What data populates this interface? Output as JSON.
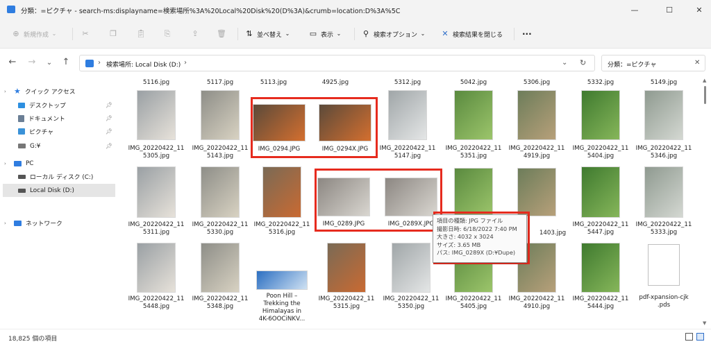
{
  "window": {
    "title": "分類：=ピクチャ - search-ms:displayname=検索場所%3A%20Local%20Disk%20(D%3A)&crumb=location:D%3A%5C",
    "minimize_glyph": "—",
    "maximize_glyph": "☐",
    "close_glyph": "✕"
  },
  "toolbar": {
    "new_label": "新規作成",
    "sort_label": "並べ替え",
    "view_label": "表示",
    "search_options_label": "検索オプション",
    "close_search_label": "検索結果を閉じる",
    "more_label": "···"
  },
  "address": {
    "path_label": "検索場所: Local Disk (D:)",
    "separator": "›",
    "search_value": "分類：=ピクチャ"
  },
  "sidebar": {
    "quick_access": "クイック アクセス",
    "items": [
      {
        "label": "デスクトップ",
        "pinned": true
      },
      {
        "label": "ドキュメント",
        "pinned": true
      },
      {
        "label": "ピクチャ",
        "pinned": true
      },
      {
        "label": "G:¥",
        "pinned": true
      }
    ],
    "pc": "PC",
    "local_c": "ローカル ディスク (C:)",
    "local_d": "Local Disk (D:)",
    "network": "ネットワーク"
  },
  "files": {
    "row0": [
      "5116.jpg",
      "5117.jpg",
      "5113.jpg",
      "4925.jpg",
      "5312.jpg",
      "5042.jpg",
      "5306.jpg",
      "5332.jpg",
      "5149.jpg"
    ],
    "row1": [
      "IMG_20220422_11\n5305.jpg",
      "IMG_20220422_11\n5143.jpg",
      "IMG_0294.JPG",
      "IMG_0294X.JPG",
      "IMG_20220422_11\n5147.jpg",
      "IMG_20220422_11\n5351.jpg",
      "IMG_20220422_11\n4919.jpg",
      "IMG_20220422_11\n5404.jpg",
      "IMG_20220422_11\n5346.jpg"
    ],
    "row2": [
      "IMG_20220422_11\n5311.jpg",
      "IMG_20220422_11\n5330.jpg",
      "IMG_20220422_11\n5316.jpg",
      "IMG_0289.JPG",
      "IMG_0289X.JPG",
      "",
      "1403.jpg",
      "IMG_20220422_11\n5447.jpg",
      "IMG_20220422_11\n5333.jpg"
    ],
    "row3": [
      "IMG_20220422_11\n5448.jpg",
      "IMG_20220422_11\n5348.jpg",
      "Poon Hill –\nTrekking the\nHimalayas in\n4K-6OOCiNKV...",
      "IMG_20220422_11\n5315.jpg",
      "IMG_20220422_11\n5350.jpg",
      "IMG_20220422_11\n5405.jpg",
      "IMG_20220422_11\n4910.jpg",
      "IMG_20220422_11\n5444.jpg",
      "pdf-xpansion-cjk\n.pds"
    ]
  },
  "tooltip": {
    "type": "項目の種類: JPG ファイル",
    "date": "撮影日時: 6/18/2022 7:40 PM",
    "size_px": "大きさ: 4032 x 3024",
    "size": "サイズ: 3.65 MB",
    "path": "パス: IMG_0289X (D:¥Dupe)"
  },
  "status": {
    "count": "18,825 個の項目"
  },
  "colors": {
    "highlight": "#e62b1e",
    "folder": "#2f7de0"
  }
}
